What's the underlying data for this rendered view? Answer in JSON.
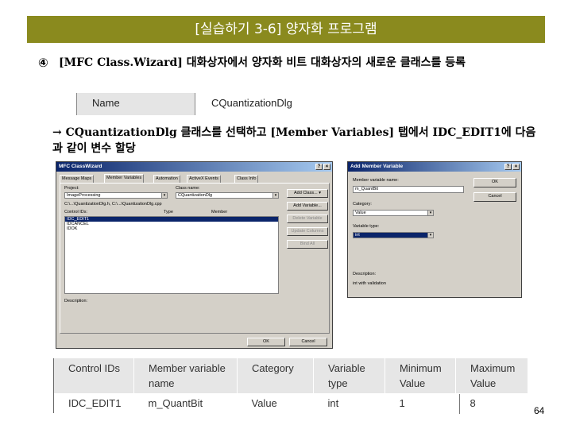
{
  "header": {
    "title": "[실습하기 3-6] 양자화 프로그램"
  },
  "step": {
    "number": "④",
    "text": "[MFC Class.Wizard] 대화상자에서 양자화 비트 대화상자의 새로운 클래스를 등록"
  },
  "name_strip": {
    "label": "Name",
    "value": "CQuantizationDlg"
  },
  "instruction": "→ CQuantizationDlg 클래스를 선택하고 [Member Variables] 탭에서 IDC_EDIT1에 다음과 같이 변수 할당",
  "class_wizard": {
    "title": "MFC ClassWizard",
    "tabs": [
      "Message Maps",
      "Member Variables",
      "Automation",
      "ActiveX Events",
      "Class Info"
    ],
    "project_label": "Project:",
    "project_value": "ImageProcessing",
    "classname_label": "Class name:",
    "classname_value": "CQuantizationDlg",
    "path_text": "C:\\...\\QuantizationDlg.h, C:\\...\\QuantizationDlg.cpp",
    "control_ids_label": "Control IDs:",
    "type_label": "Type",
    "member_label": "Member",
    "control_ids": [
      "IDC_EDIT1",
      "IDCANCEL",
      "IDOK"
    ],
    "buttons": [
      "Add Class...",
      "Add Variable...",
      "Delete Variable",
      "Update Columns",
      "Bind All"
    ],
    "description_label": "Description:",
    "ok": "OK",
    "cancel": "Cancel"
  },
  "add_member": {
    "title": "Add Member Variable",
    "name_label": "Member variable name:",
    "name_value": "m_QuantBit",
    "ok": "OK",
    "cancel": "Cancel",
    "category_label": "Category:",
    "category_value": "Value",
    "vartype_label": "Variable type:",
    "vartype_value": "int",
    "description_label": "Description:",
    "description_value": "int with validation"
  },
  "table": {
    "headers": [
      [
        "Control IDs"
      ],
      [
        "Member variable",
        "name"
      ],
      [
        "Category"
      ],
      [
        "Variable",
        "type"
      ],
      [
        "Minimum",
        "Value"
      ],
      [
        "Maximum",
        "Value"
      ]
    ],
    "rows": [
      [
        "IDC_EDIT1",
        "m_QuantBit",
        "Value",
        "int",
        "1",
        "8"
      ]
    ]
  },
  "page_number": "64"
}
